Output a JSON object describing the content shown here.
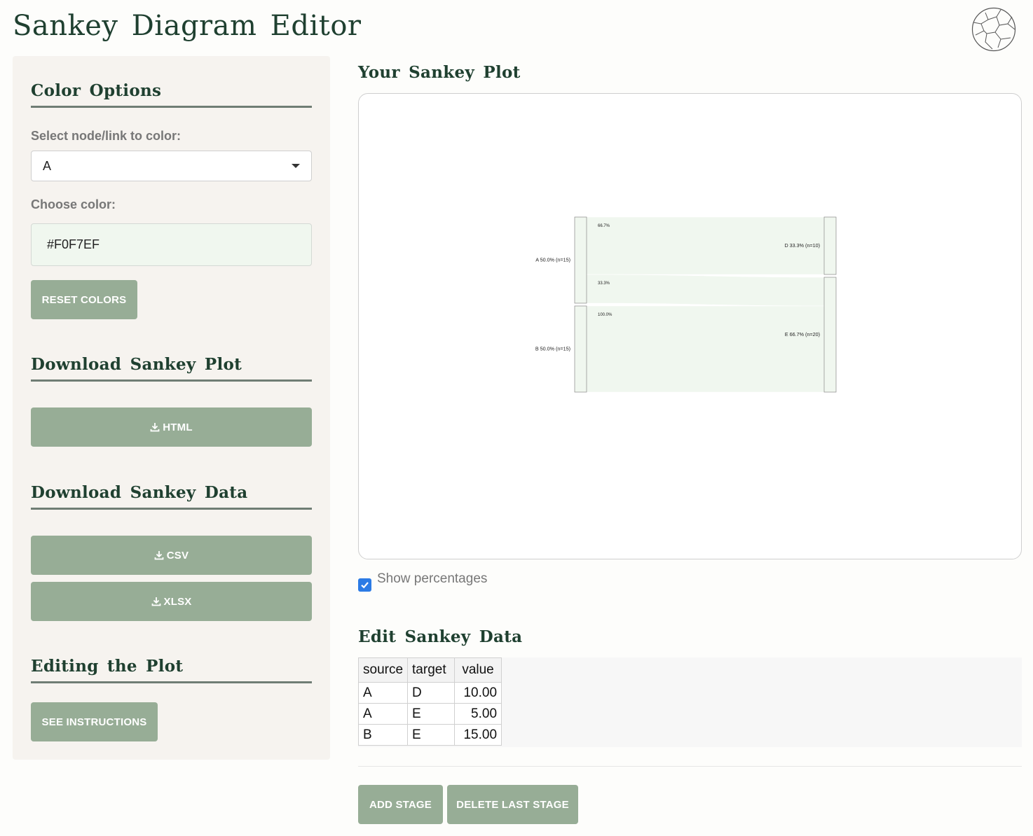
{
  "app": {
    "title": "Sankey Diagram Editor",
    "logo_icon": "globe-network-icon"
  },
  "sidebar": {
    "color_options": {
      "title": "Color Options",
      "select_label": "Select node/link to color:",
      "select_value": "A",
      "color_label": "Choose color:",
      "color_value": "#F0F7EF",
      "reset_label": "RESET COLORS"
    },
    "download_plot": {
      "title": "Download Sankey Plot",
      "html_label": "HTML"
    },
    "download_data": {
      "title": "Download Sankey Data",
      "csv_label": "CSV",
      "xlsx_label": "XLSX"
    },
    "editing": {
      "title": "Editing the Plot",
      "instructions_label": "SEE INSTRUCTIONS"
    }
  },
  "main": {
    "plot_title": "Your Sankey Plot",
    "show_percentages_label": "Show percentages",
    "show_percentages_checked": true,
    "edit_title": "Edit Sankey Data",
    "add_stage_label": "ADD STAGE",
    "delete_stage_label": "DELETE LAST STAGE"
  },
  "table": {
    "columns": [
      "source",
      "target",
      "value"
    ],
    "rows": [
      [
        "A",
        "D",
        "10.00"
      ],
      [
        "A",
        "E",
        "5.00"
      ],
      [
        "B",
        "E",
        "15.00"
      ]
    ]
  },
  "chart_data": {
    "type": "sankey",
    "nodes": [
      {
        "name": "A",
        "label": "A 50.0% (n=15)",
        "value": 15,
        "column": 0
      },
      {
        "name": "B",
        "label": "B 50.0% (n=15)",
        "value": 15,
        "column": 0
      },
      {
        "name": "D",
        "label": "D 33.3% (n=10)",
        "value": 10,
        "column": 1
      },
      {
        "name": "E",
        "label": "E 66.7% (n=20)",
        "value": 20,
        "column": 1
      }
    ],
    "links": [
      {
        "source": "A",
        "target": "D",
        "value": 10,
        "label": "66.7%"
      },
      {
        "source": "A",
        "target": "E",
        "value": 5,
        "label": "33.3%"
      },
      {
        "source": "B",
        "target": "E",
        "value": 15,
        "label": "100.0%"
      }
    ],
    "node_color": "#F0F7EF",
    "link_color": "#F0F7EF"
  },
  "colors": {
    "accent": "#97AD96",
    "title": "#1F4030",
    "sidebar_bg": "#F6F3EF"
  }
}
